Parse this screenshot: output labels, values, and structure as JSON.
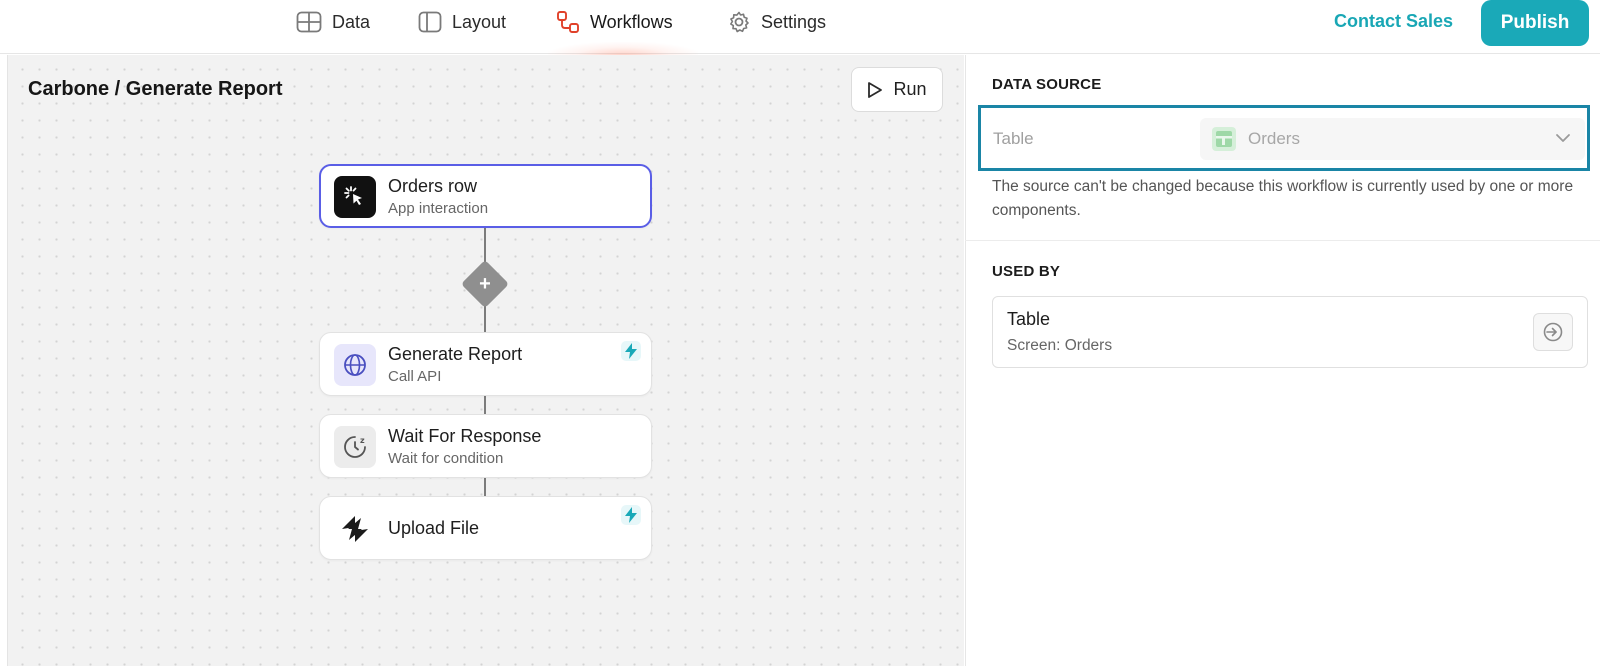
{
  "nav": {
    "data": "Data",
    "layout": "Layout",
    "workflows": "Workflows",
    "settings": "Settings",
    "active": "workflows"
  },
  "header": {
    "contact_sales": "Contact Sales",
    "publish": "Publish",
    "accent_color": "#1aa9b8"
  },
  "canvas": {
    "title": "Carbone / Generate Report",
    "run_label": "Run",
    "nodes": [
      {
        "title": "Orders row",
        "subtitle": "App interaction",
        "icon": "cursor-click-icon",
        "selected": true
      },
      {
        "title": "Generate Report",
        "subtitle": "Call API",
        "icon": "globe-icon",
        "bolt": true
      },
      {
        "title": "Wait For Response",
        "subtitle": "Wait for condition",
        "icon": "timer-icon"
      },
      {
        "title": "Upload File",
        "subtitle": "",
        "icon": "zap-logo-icon",
        "bolt": true
      }
    ],
    "add_step_symbol": "+"
  },
  "panel": {
    "data_source_title": "DATA SOURCE",
    "table_label": "Table",
    "table_value": "Orders",
    "note": "The source can't be changed because this workflow is currently used by one or more components.",
    "used_by_title": "USED BY",
    "used_by": [
      {
        "name": "Table",
        "screen": "Screen: Orders"
      }
    ]
  }
}
